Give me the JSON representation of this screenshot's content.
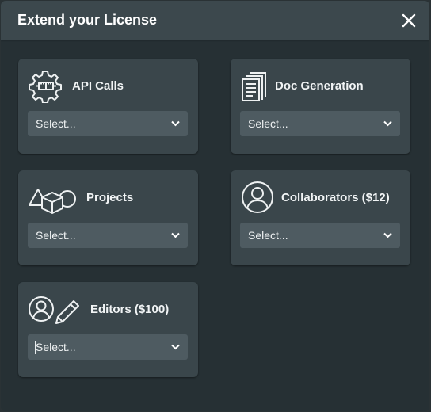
{
  "dialog": {
    "title": "Extend your License",
    "close_icon": "close-icon"
  },
  "options": [
    {
      "id": "api-calls",
      "label": "API Calls",
      "icon": "gear-plug-icon",
      "select": {
        "value": "Select..."
      }
    },
    {
      "id": "doc-generation",
      "label": "Doc Generation",
      "icon": "documents-icon",
      "select": {
        "value": "Select..."
      }
    },
    {
      "id": "projects",
      "label": "Projects",
      "icon": "shapes-icon",
      "select": {
        "value": "Select..."
      }
    },
    {
      "id": "collaborators",
      "label": "Collaborators ($12)",
      "icon": "user-circle-icon",
      "select": {
        "value": "Select..."
      }
    },
    {
      "id": "editors",
      "label": "Editors ($100)",
      "icon": "user-pencil-icon",
      "select": {
        "value": "Select..."
      }
    }
  ],
  "colors": {
    "background": "#263034",
    "header": "#3c484d",
    "card": "#3a464b",
    "select": "#4e5b61",
    "text": "#ffffff"
  }
}
